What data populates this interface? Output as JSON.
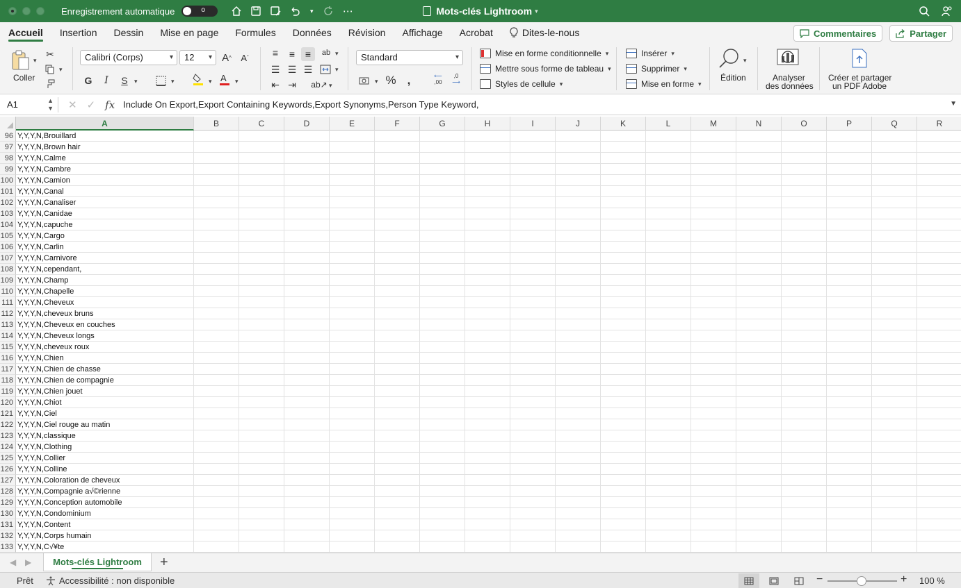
{
  "titlebar": {
    "autosave_label": "Enregistrement automatique",
    "autosave_state": "o",
    "doc_title": "Mots-clés Lightroom"
  },
  "menu": {
    "tabs": [
      "Accueil",
      "Insertion",
      "Dessin",
      "Mise en page",
      "Formules",
      "Données",
      "Révision",
      "Affichage",
      "Acrobat"
    ],
    "tell_me": "Dites-le-nous",
    "comments": "Commentaires",
    "share": "Partager"
  },
  "ribbon": {
    "paste_label": "Coller",
    "font_name": "Calibri (Corps)",
    "font_size": "12",
    "bold": "G",
    "italic": "I",
    "underline": "S",
    "number_format": "Standard",
    "conditional_format": "Mise en forme conditionnelle",
    "format_as_table": "Mettre sous forme de tableau",
    "cell_styles": "Styles de cellule",
    "insert": "Insérer",
    "delete": "Supprimer",
    "format": "Mise en forme",
    "editing": "Édition",
    "analyze_line1": "Analyser",
    "analyze_line2": "des données",
    "pdf_line1": "Créer et partager",
    "pdf_line2": "un PDF Adobe",
    "decrease_decimal": ",00",
    "increase_decimal": ",0"
  },
  "formula_bar": {
    "name_box": "A1",
    "fx": "fx",
    "content": "Include On Export,Export Containing Keywords,Export Synonyms,Person Type Keyword,"
  },
  "grid": {
    "columns": [
      "A",
      "B",
      "C",
      "D",
      "E",
      "F",
      "G",
      "H",
      "I",
      "J",
      "K",
      "L",
      "M",
      "N",
      "O",
      "P",
      "Q",
      "R"
    ],
    "rows": [
      {
        "n": "96",
        "a": "Y,Y,Y,N,Brouillard"
      },
      {
        "n": "97",
        "a": "Y,Y,Y,N,Brown hair"
      },
      {
        "n": "98",
        "a": "Y,Y,Y,N,Calme"
      },
      {
        "n": "99",
        "a": "Y,Y,Y,N,Cambre"
      },
      {
        "n": "100",
        "a": "Y,Y,Y,N,Camion"
      },
      {
        "n": "101",
        "a": "Y,Y,Y,N,Canal"
      },
      {
        "n": "102",
        "a": "Y,Y,Y,N,Canaliser"
      },
      {
        "n": "103",
        "a": "Y,Y,Y,N,Canidae"
      },
      {
        "n": "104",
        "a": "Y,Y,Y,N,capuche"
      },
      {
        "n": "105",
        "a": "Y,Y,Y,N,Cargo"
      },
      {
        "n": "106",
        "a": "Y,Y,Y,N,Carlin"
      },
      {
        "n": "107",
        "a": "Y,Y,Y,N,Carnivore"
      },
      {
        "n": "108",
        "a": "Y,Y,Y,N,cependant,"
      },
      {
        "n": "109",
        "a": "Y,Y,Y,N,Champ"
      },
      {
        "n": "110",
        "a": "Y,Y,Y,N,Chapelle"
      },
      {
        "n": "111",
        "a": "Y,Y,Y,N,Cheveux"
      },
      {
        "n": "112",
        "a": "Y,Y,Y,N,cheveux bruns"
      },
      {
        "n": "113",
        "a": "Y,Y,Y,N,Cheveux en couches"
      },
      {
        "n": "114",
        "a": "Y,Y,Y,N,Cheveux longs"
      },
      {
        "n": "115",
        "a": "Y,Y,Y,N,cheveux roux"
      },
      {
        "n": "116",
        "a": "Y,Y,Y,N,Chien"
      },
      {
        "n": "117",
        "a": "Y,Y,Y,N,Chien de chasse"
      },
      {
        "n": "118",
        "a": "Y,Y,Y,N,Chien de compagnie"
      },
      {
        "n": "119",
        "a": "Y,Y,Y,N,Chien jouet"
      },
      {
        "n": "120",
        "a": "Y,Y,Y,N,Chiot"
      },
      {
        "n": "121",
        "a": "Y,Y,Y,N,Ciel"
      },
      {
        "n": "122",
        "a": "Y,Y,Y,N,Ciel rouge au matin"
      },
      {
        "n": "123",
        "a": "Y,Y,Y,N,classique"
      },
      {
        "n": "124",
        "a": "Y,Y,Y,N,Clothing"
      },
      {
        "n": "125",
        "a": "Y,Y,Y,N,Collier"
      },
      {
        "n": "126",
        "a": "Y,Y,Y,N,Colline"
      },
      {
        "n": "127",
        "a": "Y,Y,Y,N,Coloration de cheveux"
      },
      {
        "n": "128",
        "a": "Y,Y,Y,N,Compagnie a√©rienne"
      },
      {
        "n": "129",
        "a": "Y,Y,Y,N,Conception automobile"
      },
      {
        "n": "130",
        "a": "Y,Y,Y,N,Condominium"
      },
      {
        "n": "131",
        "a": "Y,Y,Y,N,Content"
      },
      {
        "n": "132",
        "a": "Y,Y,Y,N,Corps humain"
      },
      {
        "n": "133",
        "a": "Y,Y,Y,N,C√¥te"
      }
    ]
  },
  "sheets": {
    "active": "Mots-clés Lightroom",
    "add": "+"
  },
  "status": {
    "ready": "Prêt",
    "accessibility": "Accessibilité : non disponible",
    "zoom": "100 %",
    "zoom_out": "−",
    "zoom_in": "+"
  },
  "colors": {
    "brand_green": "#2f7d43",
    "font_color_bar": "#e02020",
    "highlight_bar": "#ffe100"
  }
}
